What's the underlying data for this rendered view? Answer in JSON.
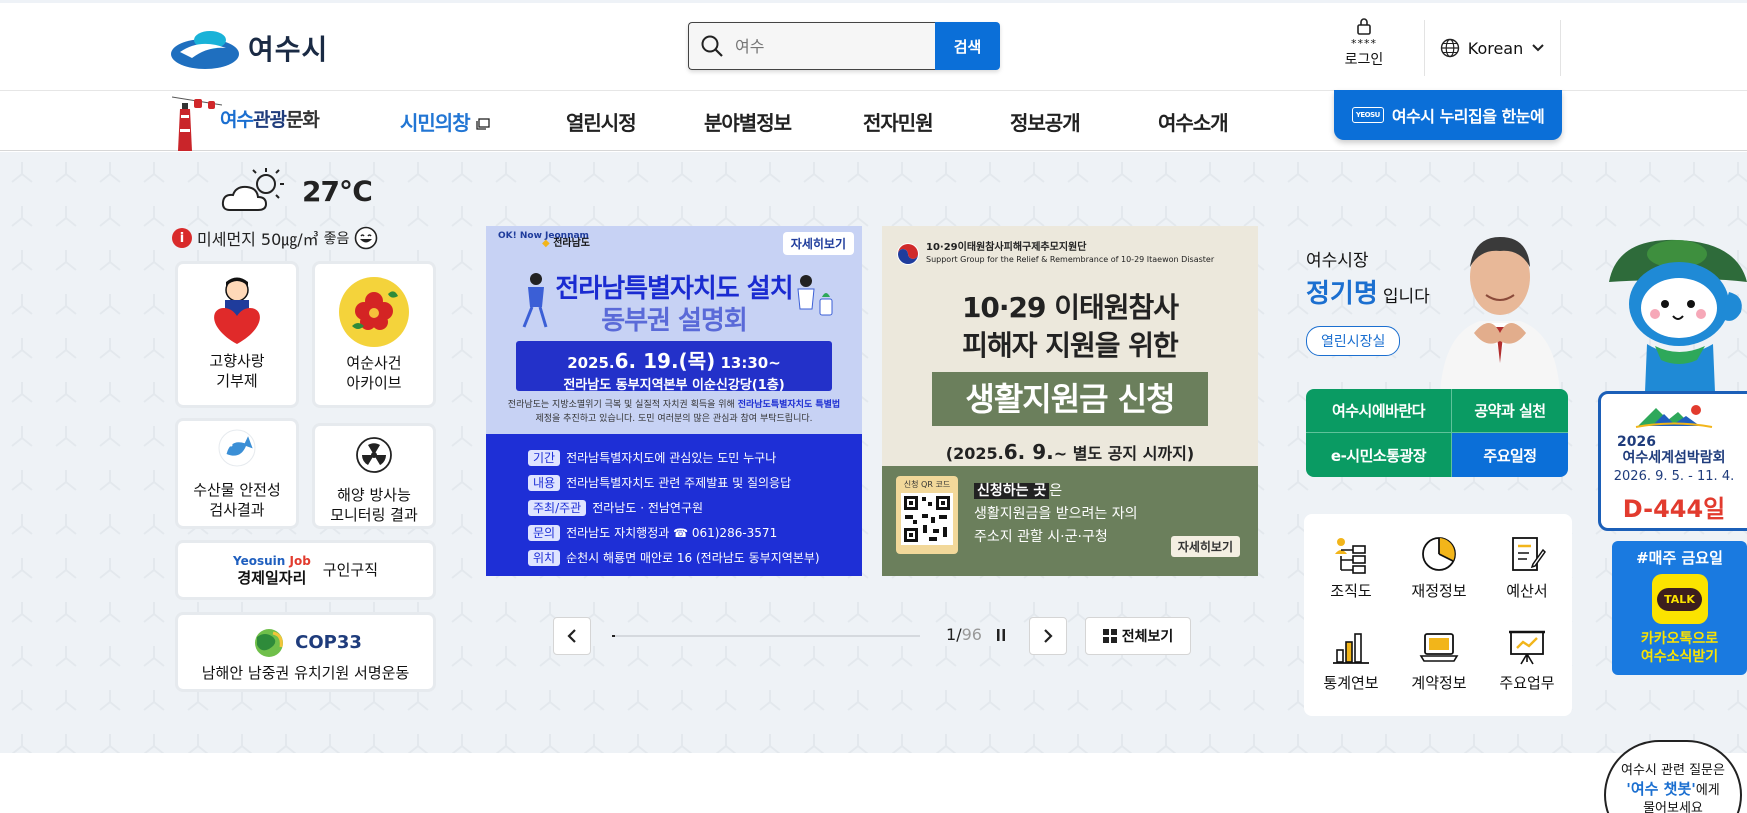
{
  "header": {
    "logo_text": "여수시",
    "search": {
      "placeholder": "여수",
      "button_label": "검색"
    },
    "login": {
      "stars": "****",
      "label": "로그인"
    },
    "language": {
      "label": "Korean"
    }
  },
  "nav": {
    "tour_label_a": "여수",
    "tour_label_b": "관광",
    "tour_label_c": "문화",
    "items": [
      {
        "label": "시민의창"
      },
      {
        "label": "열린시정"
      },
      {
        "label": "분야별정보"
      },
      {
        "label": "전자민원"
      },
      {
        "label": "정보공개"
      },
      {
        "label": "여수소개"
      }
    ],
    "cta_label": "여수시 누리집을 한눈에",
    "cta_badge": "YEOSU"
  },
  "weather": {
    "temperature": "27℃",
    "dust_label": "미세먼지",
    "dust_value": "50㎍/㎥",
    "dust_status": "좋음"
  },
  "quick_cards": [
    {
      "line1": "고향사랑",
      "line2": "기부제"
    },
    {
      "line1": "여순사건",
      "line2": "아카이브"
    },
    {
      "line1": "수산물 안전성",
      "line2": "검사결과"
    },
    {
      "line1": "해양 방사능",
      "line2": "모니터링 결과"
    }
  ],
  "job_card": {
    "brand_a": "Yeosuin",
    "brand_b": "Job",
    "title": "경제일자리",
    "label": "구인구직"
  },
  "cop_card": {
    "logo": "COP33",
    "label": "남해안 남중권 유치기원 서명운동"
  },
  "banner1": {
    "brand": "OK! Now Jeonnam",
    "org": "전라남도",
    "more": "자세히보기",
    "title_1": "전라남특별자치도 설치",
    "title_2": "동부권 설명회",
    "date_pre": "2025.",
    "date_big": "6. 19.(목)",
    "date_time": "13:30~",
    "venue": "전라남도 동부지역본부 이순신강당(1층)",
    "desc_1": "전라남도는 지방소멸위기 극복 및 실질적 자치권 획득을 위해",
    "desc_1b": "전라남도특별자치도 특별법",
    "desc_2": "제정을 추진하고 있습니다. 도민 여러분의 많은 관심과 참여 부탁드립니다.",
    "rows": [
      {
        "k": "기간",
        "v": "전라남특별자치도에 관심있는 도민 누구나"
      },
      {
        "k": "내용",
        "v": "전라남특별자치도 관련 주제발표 및 질의응답"
      },
      {
        "k": "주최/주관",
        "v": "전라남도 · 전남연구원"
      },
      {
        "k": "문의",
        "v": "전라남도 자치행정과 ☎ 061)286-3571"
      },
      {
        "k": "위치",
        "v": "순천시 해룡면 매안로 16 (전라남도 동부지역본부)"
      }
    ]
  },
  "banner2": {
    "org_ko": "10·29이태원참사피해구제추모지원단",
    "org_en": "Support Group for the Relief & Remembrance of 10-29 Itaewon Disaster",
    "title_1": "10·29 이태원참사",
    "title_2": "피해자 지원을 위한",
    "title_3": "생활지원금 신청",
    "period_pre": "(2025.",
    "period_big": "6. 9.",
    "period_post": "~ 별도 공지 시까지)",
    "qr_label": "신청 QR 코드",
    "apply_hl": "신청하는 곳",
    "apply_1": "은",
    "apply_2": "생활지원금을 받으려는 자의",
    "apply_3": "주소지 관할 시·군·구청",
    "more": "자세히보기"
  },
  "slider": {
    "current": "1",
    "separator": "/",
    "total": "96",
    "view_all": "전체보기"
  },
  "mayor": {
    "role": "여수시장",
    "name": "정기명",
    "suffix": "입니다",
    "button": "열린시장실"
  },
  "mayor_links": [
    {
      "label": "여수시에바란다"
    },
    {
      "label": "공약과 실천"
    },
    {
      "label": "e-시민소통광장"
    },
    {
      "label": "주요일정"
    }
  ],
  "quick_links": [
    {
      "label": "조직도",
      "icon": "org-chart-icon"
    },
    {
      "label": "재정정보",
      "icon": "pie-chart-icon"
    },
    {
      "label": "예산서",
      "icon": "document-edit-icon"
    },
    {
      "label": "통계연보",
      "icon": "bar-chart-icon"
    },
    {
      "label": "계약정보",
      "icon": "laptop-icon"
    },
    {
      "label": "주요업무",
      "icon": "presentation-icon"
    }
  ],
  "expo": {
    "year": "2026",
    "title": "여수세계섬박람회",
    "dates": "2026. 9. 5. - 11. 4.",
    "dday": "D-444일"
  },
  "kakao": {
    "hashtag": "#매주 금요일",
    "badge": "TALK",
    "line1": "카카오톡으로",
    "line2": "여수소식받기"
  },
  "chatbot": {
    "line1": "여수시 관련 질문은",
    "line2a": "'여수 챗봇'",
    "line2b": "에게",
    "line3": "물어보세요"
  },
  "colors": {
    "primary": "#0b6fd8",
    "green": "#0a9b63",
    "navy": "#1f3c7c",
    "dday": "#e23b2e"
  }
}
